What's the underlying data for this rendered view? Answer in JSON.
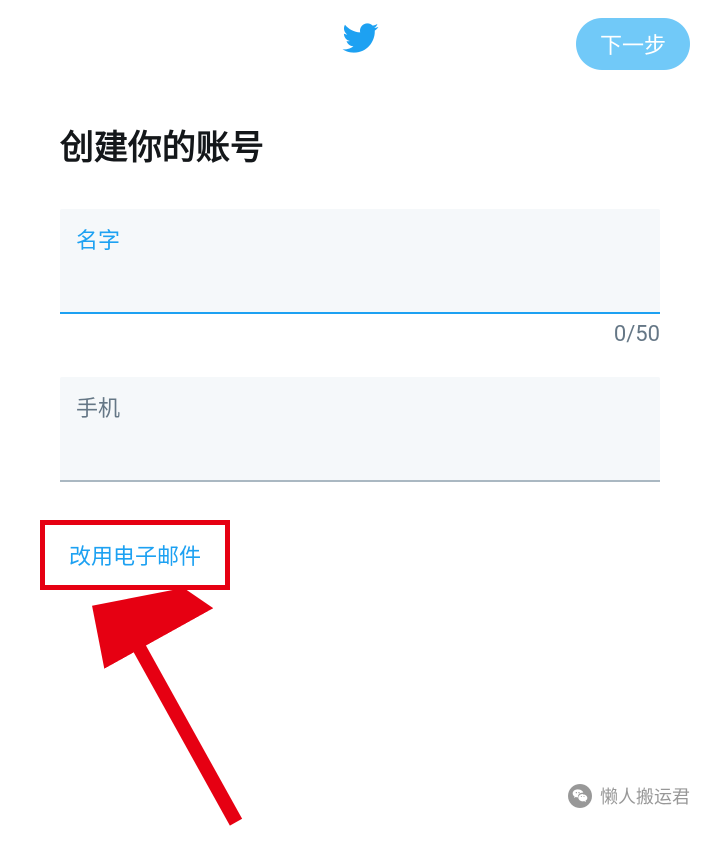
{
  "header": {
    "next_button": "下一步"
  },
  "main": {
    "title": "创建你的账号",
    "name_field": {
      "label": "名字",
      "value": "",
      "counter": "0/50"
    },
    "phone_field": {
      "label": "手机",
      "value": ""
    },
    "switch_link": "改用电子邮件"
  },
  "watermark": {
    "text": "懒人搬运君"
  }
}
